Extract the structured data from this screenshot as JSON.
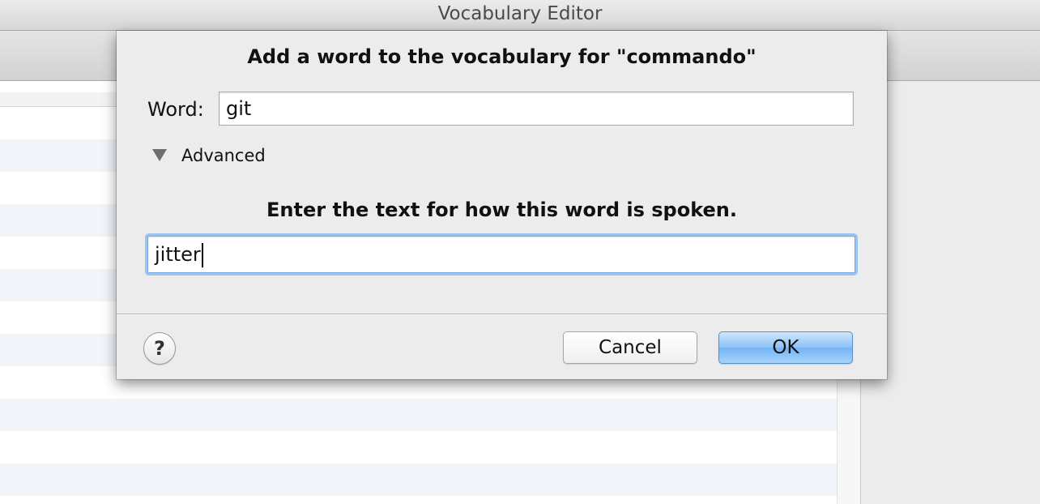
{
  "window": {
    "title": "Vocabulary Editor"
  },
  "dialog": {
    "title": "Add a word to the vocabulary for \"commando\"",
    "word_label": "Word:",
    "word_value": "git",
    "advanced_label": "Advanced",
    "advanced_expanded": true,
    "instruction": "Enter the text for how this word is spoken.",
    "spoken_value": "jitter",
    "help_label": "?",
    "cancel_label": "Cancel",
    "ok_label": "OK"
  },
  "colors": {
    "default_button": "#8cc2f7",
    "focus_ring": "#9bc3ef",
    "list_alt_row": "#f1f5fa"
  }
}
